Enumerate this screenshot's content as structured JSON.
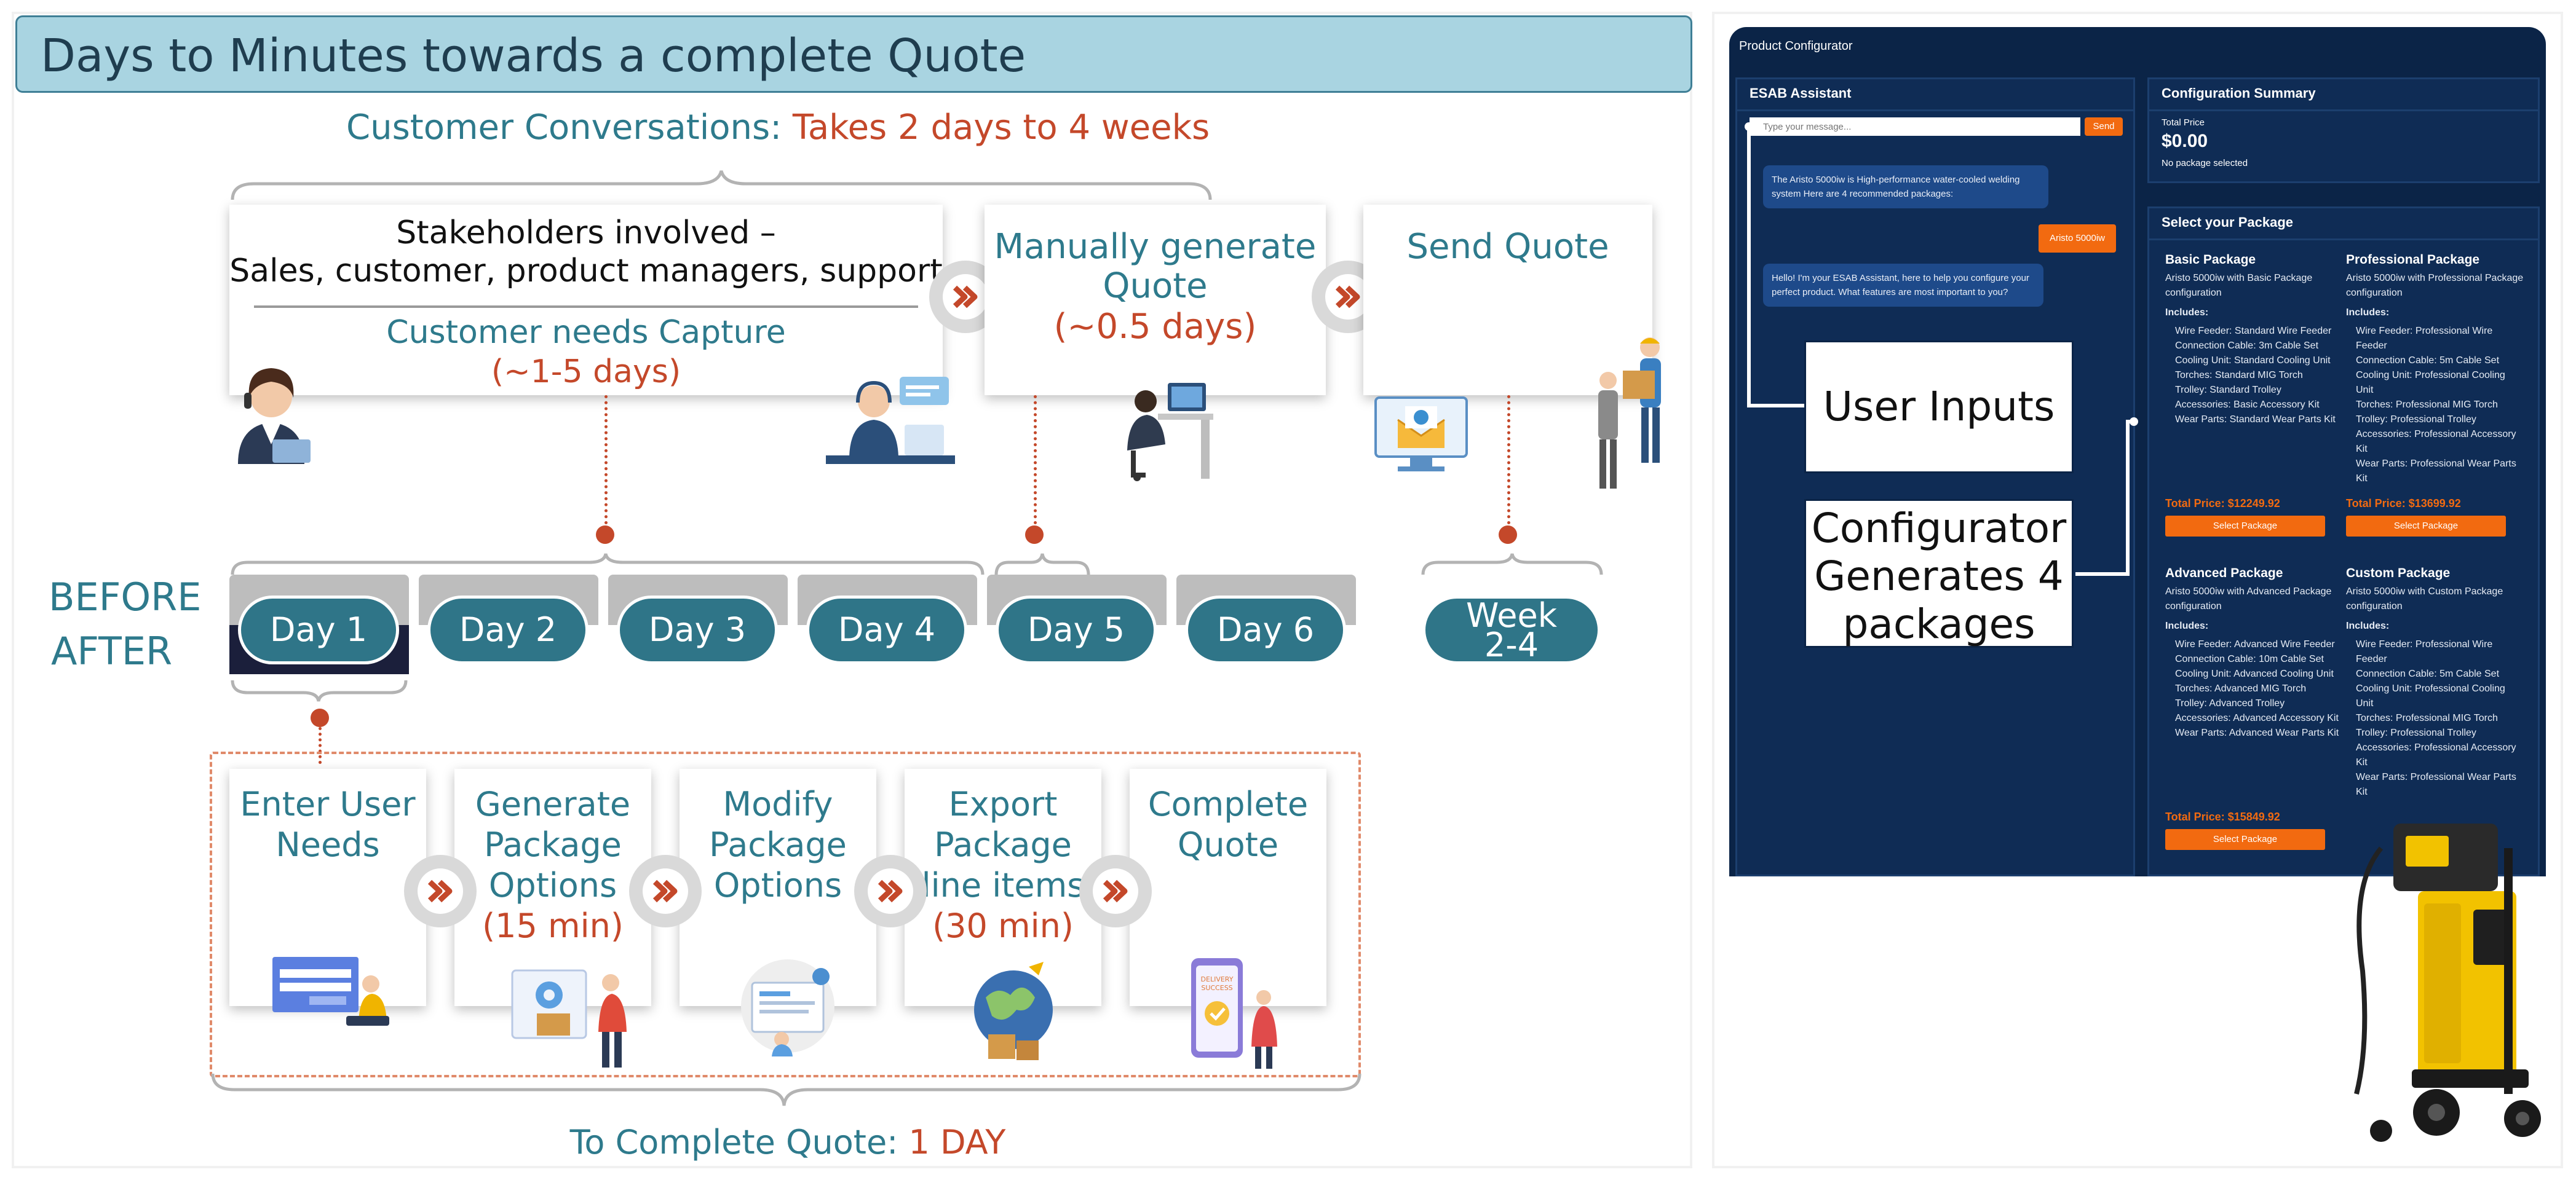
{
  "title": "Days to Minutes towards a complete Quote",
  "conversations": {
    "label": "Customer Conversations:",
    "duration": "Takes 2 days to 4 weeks"
  },
  "before_cards": {
    "stakeholders_line1": "Stakeholders involved –",
    "stakeholders_line2": "Sales, customer, product managers, support",
    "capture_label": "Customer needs Capture",
    "capture_time": "(~1-5 days)",
    "manual_line1": "Manually generate",
    "manual_line2": "Quote",
    "manual_time": "(~0.5 days)",
    "send_quote": "Send Quote"
  },
  "timeline": {
    "before_label": "BEFORE",
    "after_label": "AFTER",
    "days": [
      "Day 1",
      "Day 2",
      "Day 3",
      "Day 4",
      "Day 5",
      "Day 6"
    ],
    "week_line1": "Week",
    "week_line2": "2-4"
  },
  "after_steps": [
    {
      "line1": "Enter User",
      "line2": "Needs",
      "line3": "",
      "time": ""
    },
    {
      "line1": "Generate",
      "line2": "Package",
      "line3": "Options",
      "time": "(15 min)"
    },
    {
      "line1": "Modify",
      "line2": "Package",
      "line3": "Options",
      "time": ""
    },
    {
      "line1": "Export",
      "line2": "Package",
      "line3": "line items",
      "time": "(30 min)"
    },
    {
      "line1": "Complete",
      "line2": "Quote",
      "line3": "",
      "time": ""
    }
  ],
  "illustration_text": {
    "delivery_line1": "DELIVERY",
    "delivery_line2": "SUCCESS"
  },
  "complete": {
    "label": "To Complete Quote:",
    "value": "1 DAY"
  },
  "configurator": {
    "window_title": "Product Configurator",
    "assistant_title": "ESAB Assistant",
    "input_placeholder": "Type your message...",
    "send_label": "Send",
    "messages": [
      {
        "from": "bot",
        "text": "The Aristo 5000iw is High-performance water-cooled welding system Here are 4 recommended packages:"
      },
      {
        "from": "user",
        "text": "Aristo 5000iw"
      },
      {
        "from": "bot",
        "text": "Hello! I'm your ESAB Assistant, here to help you configure your perfect product. What features are most important to you?"
      }
    ],
    "summary_title": "Configuration Summary",
    "total_price_label": "Total Price",
    "total_price_value": "$0.00",
    "no_package": "No package selected",
    "select_title": "Select your Package",
    "includes_label": "Includes:",
    "select_button": "Select Package",
    "packages": [
      {
        "name": "Basic Package",
        "desc": "Aristo 5000iw with Basic Package configuration",
        "items": [
          "Wire Feeder: Standard Wire Feeder",
          "Connection Cable: 3m Cable Set",
          "Cooling Unit: Standard Cooling Unit",
          "Torches: Standard MIG Torch",
          "Trolley: Standard Trolley",
          "Accessories: Basic Accessory Kit",
          "Wear Parts: Standard Wear Parts Kit"
        ],
        "total": "Total Price: $12249.92"
      },
      {
        "name": "Professional Package",
        "desc": "Aristo 5000iw with Professional Package configuration",
        "items": [
          "Wire Feeder: Professional Wire Feeder",
          "Connection Cable: 5m Cable Set",
          "Cooling Unit: Professional Cooling Unit",
          "Torches: Professional MIG Torch",
          "Trolley: Professional Trolley",
          "Accessories: Professional Accessory Kit",
          "Wear Parts: Professional Wear Parts Kit"
        ],
        "total": "Total Price: $13699.92"
      },
      {
        "name": "Advanced Package",
        "desc": "Aristo 5000iw with Advanced Package configuration",
        "items": [
          "Wire Feeder: Advanced Wire Feeder",
          "Connection Cable: 10m Cable Set",
          "Cooling Unit: Advanced Cooling Unit",
          "Torches: Advanced MIG Torch",
          "Trolley: Advanced Trolley",
          "Accessories: Advanced Accessory Kit",
          "Wear Parts: Advanced Wear Parts Kit"
        ],
        "total": "Total Price: $15849.92"
      },
      {
        "name": "Custom Package",
        "desc": "Aristo 5000iw with Custom Package configuration",
        "items": [
          "Wire Feeder: Professional Wire Feeder",
          "Connection Cable: 5m Cable Set",
          "Cooling Unit: Professional Cooling Unit",
          "Torches: Professional MIG Torch",
          "Trolley: Professional Trolley",
          "Accessories: Professional Accessory Kit",
          "Wear Parts: Professional Wear Parts Kit"
        ],
        "total": ""
      }
    ]
  },
  "callouts": {
    "user_inputs": "User Inputs",
    "generates_line1": "Configurator",
    "generates_line2": "Generates 4",
    "generates_line3": "packages"
  },
  "colors": {
    "teal": "#2e7a8c",
    "rust": "#c4482a",
    "navy": "#0b2447",
    "orange": "#f26a10",
    "title_bg": "#a9d4e1"
  }
}
